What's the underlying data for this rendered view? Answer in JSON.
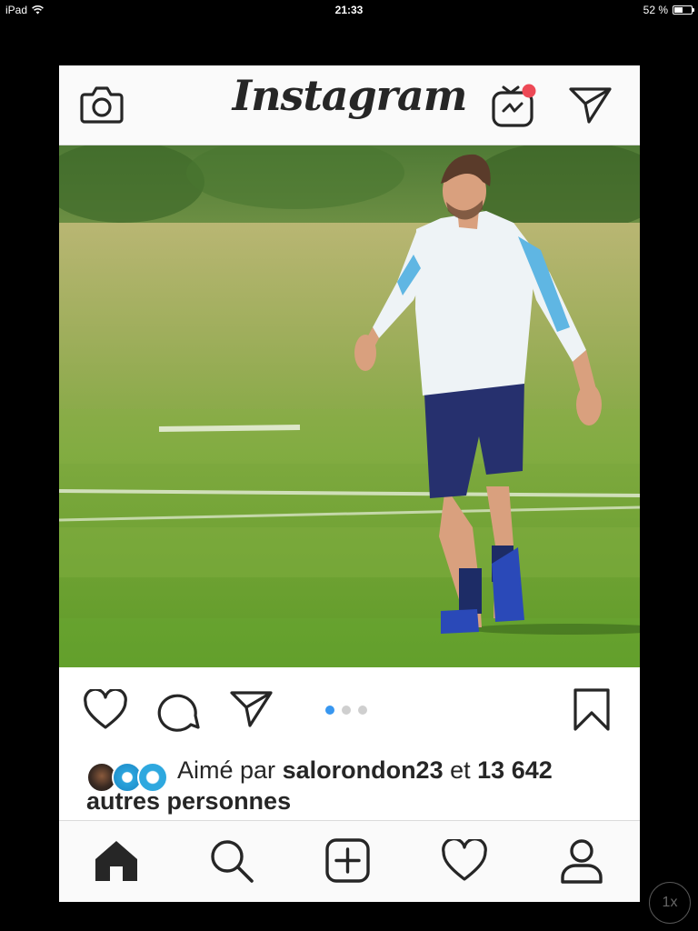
{
  "status_bar": {
    "device": "iPad",
    "time": "21:33",
    "battery_text": "52 %",
    "battery_level": 0.52
  },
  "app": {
    "logo": "Instagram"
  },
  "top_bar": {
    "icons": [
      "camera-icon",
      "igtv-icon",
      "direct-message-icon"
    ],
    "igtv_badge_color": "#ed4956"
  },
  "post": {
    "photo_description_icon": "photo",
    "carousel": {
      "count": 3,
      "active_index": 0
    },
    "likes": {
      "prefix": "Aimé par",
      "user": "salorondon23",
      "connector": "et",
      "count": "13 642",
      "suffix": "autres personnes"
    }
  },
  "bottom_nav": {
    "items": [
      "home-icon",
      "search-icon",
      "new-post-icon",
      "activity-icon",
      "profile-icon"
    ]
  },
  "zoom_badge": "1x",
  "colors": {
    "accent_blue": "#3897f0",
    "text": "#262626",
    "border": "#dbdbdb"
  }
}
